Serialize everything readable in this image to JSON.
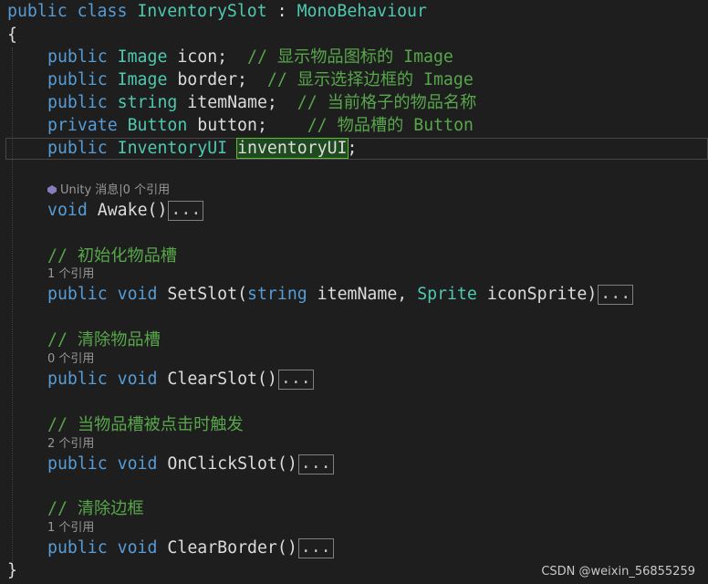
{
  "code": {
    "class_decl": {
      "kw1": "public",
      "kw2": "class",
      "name": "InventorySlot",
      "colon": " : ",
      "base": "MonoBehaviour"
    },
    "open_brace": "{",
    "close_brace": "}",
    "fields": [
      {
        "mod": "public",
        "type": "Image",
        "rest": " icon;  ",
        "comment": "// 显示物品图标的 Image"
      },
      {
        "mod": "public",
        "type": "Image",
        "rest": " border;  ",
        "comment": "// 显示选择边框的 Image"
      },
      {
        "mod": "public",
        "type": "string",
        "rest": " itemName;  ",
        "comment": "// 当前格子的物品名称"
      },
      {
        "mod": "private",
        "type": "Button",
        "rest": " button;    ",
        "comment": "// 物品槽的 Button"
      }
    ],
    "inventory_field": {
      "mod": "public",
      "type": "InventoryUI",
      "name": "inventoryUI",
      "semi": ";"
    },
    "awake": {
      "lens": "Unity 消息|0 个引用",
      "kw": "void",
      "name": "Awake",
      "args": "()",
      "collapsed": "..."
    },
    "methods": [
      {
        "comment": "// 初始化物品槽",
        "lens": "1 个引用",
        "mod": "public",
        "ret": "void",
        "name": "SetSlot",
        "collapsed": "..."
      },
      {
        "comment": "// 清除物品槽",
        "lens": "0 个引用",
        "mod": "public",
        "ret": "void",
        "name": "ClearSlot",
        "args": "()",
        "collapsed": "..."
      },
      {
        "comment": "// 当物品槽被点击时触发",
        "lens": "2 个引用",
        "mod": "public",
        "ret": "void",
        "name": "OnClickSlot",
        "args": "()",
        "collapsed": "..."
      },
      {
        "comment": "// 清除边框",
        "lens": "1 个引用",
        "mod": "public",
        "ret": "void",
        "name": "ClearBorder",
        "args": "()",
        "collapsed": "..."
      }
    ],
    "setslot_params": {
      "open": "(",
      "t1": "string",
      "p1": " itemName, ",
      "t2": "Sprite",
      "p2": " iconSprite",
      "close": ")"
    }
  },
  "watermark": "CSDN @weixin_56855259",
  "colors": {
    "keyword": "#569cd6",
    "type": "#4ec9b0",
    "comment": "#57a64a",
    "background": "#1e1e1e"
  }
}
